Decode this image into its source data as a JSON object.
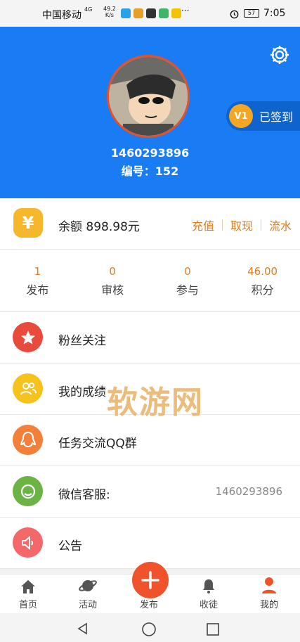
{
  "status_bar": {
    "carrier": "中国移动",
    "network": "4G",
    "speed_value": "49.2",
    "speed_unit": "K/s",
    "dots": "···",
    "battery": "57",
    "time": "7:05"
  },
  "profile": {
    "username": "1460293896",
    "id_label": "编号：",
    "id_value": "152",
    "level_badge": "V1",
    "checkin_label": "已签到"
  },
  "balance": {
    "icon_glyph": "¥",
    "label": "余额",
    "amount": "898.98元",
    "actions": [
      "充值",
      "取现",
      "流水"
    ]
  },
  "stats": [
    {
      "value": "1",
      "label": "发布"
    },
    {
      "value": "0",
      "label": "审核"
    },
    {
      "value": "0",
      "label": "参与"
    },
    {
      "value": "46.00",
      "label": "积分"
    }
  ],
  "menu": [
    {
      "label": "粉丝关注",
      "icon": "star-icon",
      "color": "#e84a3c",
      "value": ""
    },
    {
      "label": "我的成绩",
      "icon": "users-icon",
      "color": "#f6c21c",
      "value": ""
    },
    {
      "label": "任务交流QQ群",
      "icon": "qq-icon",
      "color": "#f2803a",
      "value": ""
    },
    {
      "label": "微信客服:",
      "icon": "wechat-icon",
      "color": "#6ab344",
      "value": "1460293896"
    },
    {
      "label": "公告",
      "icon": "speaker-icon",
      "color": "#f4686a",
      "value": ""
    }
  ],
  "watermark": "软游网",
  "tabbar": [
    {
      "label": "首页",
      "icon": "home-icon"
    },
    {
      "label": "活动",
      "icon": "planet-icon"
    },
    {
      "label": "发布",
      "icon": "plus-icon"
    },
    {
      "label": "收徒",
      "icon": "bell-icon"
    },
    {
      "label": "我的",
      "icon": "person-icon"
    }
  ],
  "colors": {
    "header_blue": "#1a7cf2",
    "accent_orange": "#e07d1d",
    "publish_red": "#f0522b"
  }
}
